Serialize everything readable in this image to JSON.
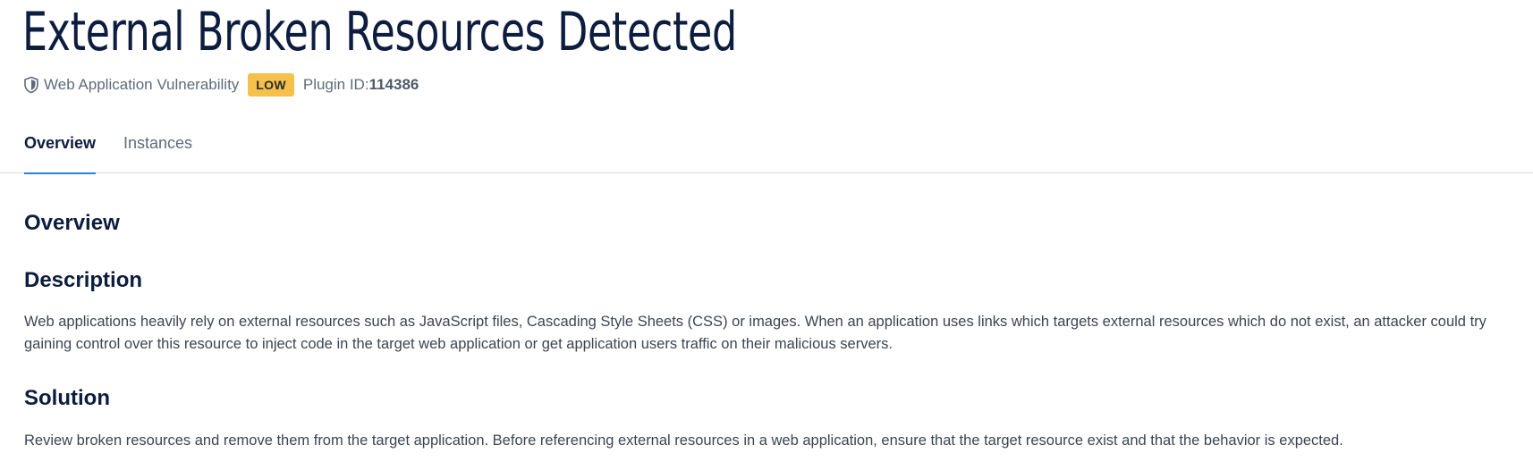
{
  "header": {
    "title": "External Broken Resources Detected",
    "category": "Web Application Vulnerability",
    "severity": "LOW",
    "plugin_label": "Plugin ID: ",
    "plugin_id": "114386",
    "category_icon": "shield-icon",
    "severity_color": "#f5c04b"
  },
  "tabs": [
    {
      "label": "Overview",
      "active": true
    },
    {
      "label": "Instances",
      "active": false
    }
  ],
  "content": {
    "overview_heading": "Overview",
    "description_heading": "Description",
    "description_text": "Web applications heavily rely on external resources such as JavaScript files, Cascading Style Sheets (CSS) or images. When an application uses links which targets external resources which do not exist, an attacker could try gaining control over this resource to inject code in the target web application or get application users traffic on their malicious servers.",
    "solution_heading": "Solution",
    "solution_text": "Review broken resources and remove them from the target application. Before referencing external resources in a web application, ensure that the target resource exist and that the behavior is expected."
  },
  "colors": {
    "title": "#0d1d3f",
    "active_tab_underline": "#2f7fdd",
    "muted_text": "#5f6b7a"
  }
}
